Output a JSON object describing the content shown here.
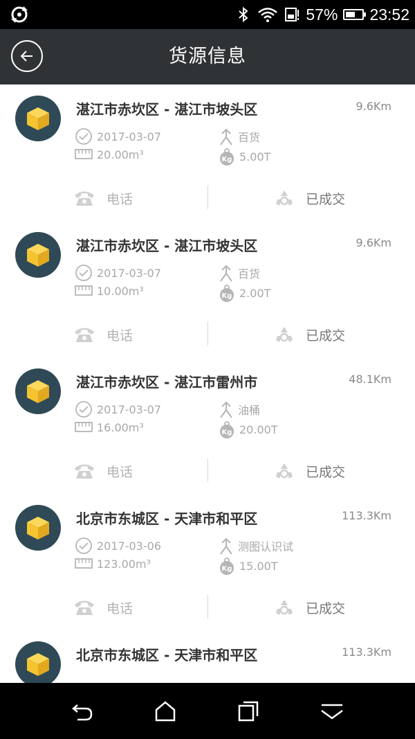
{
  "status_bar": {
    "battery_text": "57%",
    "battery_level": 0.57,
    "time": "23:52",
    "icons": [
      "sync-icon",
      "bluetooth-icon",
      "wifi-icon",
      "sim-icon"
    ]
  },
  "header": {
    "title": "货源信息",
    "back_icon": "back-arrow-icon"
  },
  "colors": {
    "header_bg": "#2f3335",
    "avatar_bg": "#2f4a56",
    "box_yellow": "#f6c331"
  },
  "listings": [
    {
      "route": "湛江市赤坎区 - 湛江市坡头区",
      "distance": "9.6Km",
      "date": "2017-03-07",
      "volume": "20.00m³",
      "goods_type": "百货",
      "weight": "5.00T",
      "phone_label": "电话",
      "status_label": "已成交"
    },
    {
      "route": "湛江市赤坎区 - 湛江市坡头区",
      "distance": "9.6Km",
      "date": "2017-03-07",
      "volume": "10.00m³",
      "goods_type": "百货",
      "weight": "2.00T",
      "phone_label": "电话",
      "status_label": "已成交"
    },
    {
      "route": "湛江市赤坎区 - 湛江市雷州市",
      "distance": "48.1Km",
      "date": "2017-03-07",
      "volume": "16.00m³",
      "goods_type": "油桶",
      "weight": "20.00T",
      "phone_label": "电话",
      "status_label": "已成交"
    },
    {
      "route": "北京市东城区 - 天津市和平区",
      "distance": "113.3Km",
      "date": "2017-03-06",
      "volume": "123.00m³",
      "goods_type": "测图认识试",
      "weight": "15.00T",
      "phone_label": "电话",
      "status_label": "已成交"
    },
    {
      "route": "北京市东城区 - 天津市和平区",
      "distance": "113.3Km",
      "date": "",
      "volume": "",
      "goods_type": "",
      "weight": "",
      "phone_label": "",
      "status_label": ""
    }
  ],
  "nav_bar": {
    "icons": [
      "back-nav-icon",
      "home-icon",
      "recent-apps-icon",
      "hide-nav-icon"
    ]
  }
}
